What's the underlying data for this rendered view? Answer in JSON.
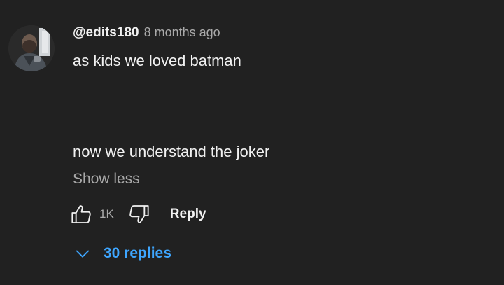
{
  "comment": {
    "author": "@edits180",
    "timestamp": "8 months ago",
    "text_lines": [
      "as kids we loved batman",
      "now we understand the joker"
    ],
    "show_less_label": "Show less",
    "like_count": "1K",
    "reply_label": "Reply",
    "replies_label": "30 replies"
  },
  "icons": {
    "like": "thumbs-up-icon",
    "dislike": "thumbs-down-icon",
    "expand": "chevron-down-icon"
  },
  "colors": {
    "background": "#212121",
    "text_primary": "#f1f1f1",
    "text_secondary": "#aaaaaa",
    "link_blue": "#3ea6ff"
  }
}
